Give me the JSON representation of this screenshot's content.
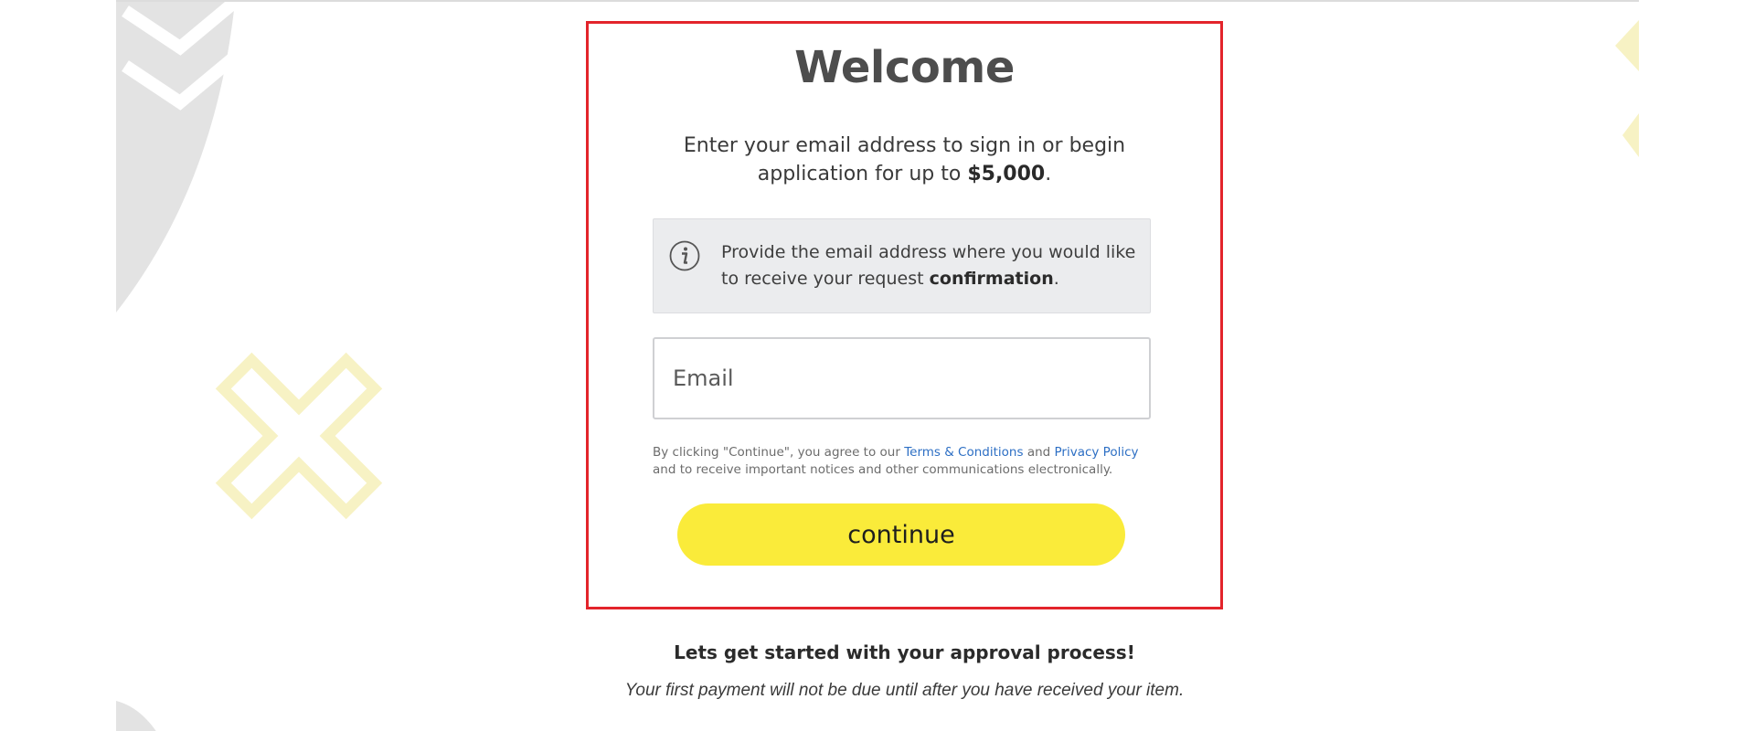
{
  "welcome": {
    "title": "Welcome",
    "intro_text": "Enter your email address to sign in or begin application for up to",
    "intro_amount": "$5,000",
    "intro_end": "."
  },
  "info_box": {
    "text": "Provide the email address where you would like to receive your request",
    "bold": "confirmation",
    "end": ".",
    "icon": "info-icon"
  },
  "email": {
    "placeholder": "Email",
    "value": ""
  },
  "legal": {
    "prefix": "By clicking \"Continue\", you agree to our",
    "terms_link": "Terms & Conditions",
    "and": "and",
    "privacy_link": "Privacy Policy",
    "suffix": "and to receive important notices and other communications electronically."
  },
  "continue_button": "continue",
  "footer": {
    "heading": "Lets get started with your approval process!",
    "note": "Your first payment will not be due until after you have received your item."
  },
  "colors": {
    "accent_yellow": "#faeb3a",
    "highlight_border": "#e3242b",
    "link_blue": "#2d6fc4"
  }
}
